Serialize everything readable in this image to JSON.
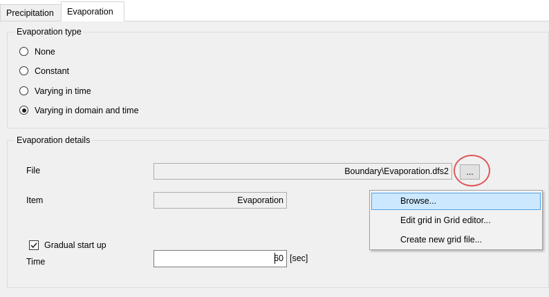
{
  "tabs": [
    {
      "label": "Precipitation",
      "active": false
    },
    {
      "label": "Evaporation",
      "active": true
    }
  ],
  "evaporation_type": {
    "title": "Evaporation type",
    "options": [
      {
        "label": "None",
        "selected": false
      },
      {
        "label": "Constant",
        "selected": false
      },
      {
        "label": "Varying in time",
        "selected": false
      },
      {
        "label": "Varying in domain and time",
        "selected": true
      }
    ]
  },
  "evaporation_details": {
    "title": "Evaporation details",
    "file_label": "File",
    "file_value": "Boundary\\Evaporation.dfs2",
    "browse_button": "...",
    "item_label": "Item",
    "item_value": "Evaporation",
    "gradual_label": "Gradual start up",
    "gradual_checked": true,
    "time_label": "Time",
    "time_value": "60",
    "time_unit": "[sec]"
  },
  "context_menu": {
    "items": [
      {
        "label": "Browse...",
        "highlighted": true
      },
      {
        "label": "Edit grid in Grid editor...",
        "highlighted": false
      },
      {
        "label": "Create new grid file...",
        "highlighted": false
      }
    ]
  },
  "colors": {
    "highlight_circle": "#e05555",
    "menu_hover": "#cce8ff",
    "menu_hover_border": "#4ea2e4"
  }
}
